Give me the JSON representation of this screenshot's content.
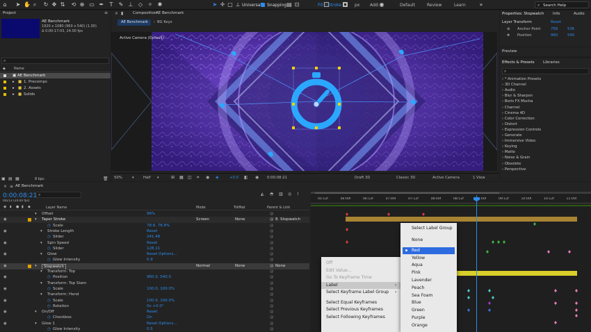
{
  "toolbar": {
    "universal_label": "Universal",
    "snapping_label": "Snapping",
    "fill_label": "Fill",
    "stroke_label": "Stroke",
    "px_label": "px",
    "add_label": "Add:",
    "workspaces": [
      "Default",
      "Review",
      "Learn"
    ],
    "search_placeholder": "Search Help"
  },
  "project": {
    "title": "Project",
    "comp_name": "AE Benchmark",
    "comp_info_1": "1920 x 1080 (960 x 540) (1.00)",
    "comp_info_2": "Δ 0:00:17:03, 24.00 fps",
    "search_placeholder": "",
    "column_name": "Name",
    "items": [
      {
        "name": "AE Benchmark",
        "color": "#d9d9d9",
        "selected": true
      },
      {
        "name": "1. Precomps",
        "color": "#e2c200",
        "selected": false
      },
      {
        "name": "2. Assets",
        "color": "#e2c200",
        "selected": false
      },
      {
        "name": "Solids",
        "color": "#e2c200",
        "selected": false
      }
    ],
    "bpc": "8 bpc"
  },
  "composition": {
    "panel_title": "Composition",
    "comp_name": "AE Benchmark",
    "tabs": [
      "AE Benchmark",
      "BG Keys"
    ],
    "camera_label": "Active Camera (Default)",
    "zoom": "50%",
    "resolution": "Half",
    "exposure": "+0.0",
    "timecode": "0:00:08:21",
    "renderer": "Draft 3D",
    "renderer_mode": "Classic 3D",
    "view": "Active Camera",
    "view_count": "1 View"
  },
  "properties": {
    "title": "Properties: Stopwatch",
    "tabs": [
      "Info",
      "Audio"
    ],
    "section": "Layer Transform",
    "reset": "Reset",
    "rows": [
      {
        "label": "Anchor Point",
        "v1": "758",
        "v2": "536"
      },
      {
        "label": "Position",
        "v1": "960",
        "v2": "540"
      }
    ],
    "preview_title": "Preview"
  },
  "effects": {
    "title": "Effects & Presets",
    "tab2": "Libraries",
    "categories": [
      "* Animation Presets",
      "3D Channel",
      "Audio",
      "Blur & Sharpen",
      "Boris FX Mocha",
      "Channel",
      "Cinema 4D",
      "Color Correction",
      "Distort",
      "Expression Controls",
      "Generate",
      "Immersive Video",
      "Keying",
      "Matte",
      "Noise & Grain",
      "Obsolete",
      "Perspective"
    ]
  },
  "timeline": {
    "tab": "AE Benchmark",
    "timecode": "0:00:08:21",
    "frames": "00213 (24.00 fps)",
    "column_headers": {
      "layer_name": "Layer Name",
      "mode": "Mode",
      "trkmat": "TrkMat",
      "parent": "Parent & Link"
    },
    "ruler": [
      "05:12f",
      "06:00f",
      "06:12f",
      "07:00f",
      "07:12f",
      "08:00f",
      "08:12f",
      "09:00f",
      "09:12f",
      "10:00f",
      "10:12f",
      "11:00f"
    ],
    "rows": [
      {
        "indent": 0,
        "name": "Offset",
        "value": "96%",
        "color": "",
        "mode": "",
        "trk": "",
        "parent": ""
      },
      {
        "indent": 0,
        "name": "Taper Stroke",
        "value": "",
        "color": "#e0a000",
        "mode": "Screen",
        "trk": "None",
        "parent": "8. Stopwatch"
      },
      {
        "indent": 2,
        "name": "Scale",
        "value": "78.8, 78.8%",
        "color": "",
        "mode": "",
        "trk": "",
        "parent": ""
      },
      {
        "indent": 1,
        "name": "Stroke Length",
        "value": "Reset",
        "color": "",
        "mode": "",
        "trk": "",
        "parent": ""
      },
      {
        "indent": 2,
        "name": "Slider",
        "value": "241.48",
        "color": "",
        "mode": "",
        "trk": "",
        "parent": ""
      },
      {
        "indent": 1,
        "name": "Spin Speed",
        "value": "Reset",
        "color": "",
        "mode": "",
        "trk": "",
        "parent": ""
      },
      {
        "indent": 2,
        "name": "Slider",
        "value": "128.11",
        "color": "",
        "mode": "",
        "trk": "",
        "parent": ""
      },
      {
        "indent": 1,
        "name": "Glow",
        "value": "Reset   Options...",
        "color": "",
        "mode": "",
        "trk": "",
        "parent": ""
      },
      {
        "indent": 2,
        "name": "Glow Intensity",
        "value": "0.9",
        "color": "",
        "mode": "",
        "trk": "",
        "parent": ""
      },
      {
        "indent": 0,
        "name": "Stopwatch",
        "value": "",
        "color": "#e0a000",
        "mode": "Normal",
        "trk": "None",
        "parent": "None"
      },
      {
        "indent": 1,
        "name": "Transform: Top",
        "value": "",
        "color": "",
        "mode": "",
        "trk": "",
        "parent": ""
      },
      {
        "indent": 2,
        "name": "Position",
        "value": "960.0, 540.0",
        "color": "",
        "mode": "",
        "trk": "",
        "parent": ""
      },
      {
        "indent": 1,
        "name": "Transform: Top Stem",
        "value": "",
        "color": "",
        "mode": "",
        "trk": "",
        "parent": ""
      },
      {
        "indent": 2,
        "name": "Scale",
        "value": "100.0, 100.0%",
        "color": "",
        "mode": "",
        "trk": "",
        "parent": ""
      },
      {
        "indent": 1,
        "name": "Transform: Hand",
        "value": "",
        "color": "",
        "mode": "",
        "trk": "",
        "parent": ""
      },
      {
        "indent": 2,
        "name": "Scale",
        "value": "100.0, 100.0%",
        "color": "",
        "mode": "",
        "trk": "",
        "parent": ""
      },
      {
        "indent": 2,
        "name": "Rotation",
        "value": "0x +0.0°",
        "color": "",
        "mode": "",
        "trk": "",
        "parent": ""
      },
      {
        "indent": 0,
        "name": "On/Off",
        "value": "Reset",
        "color": "",
        "mode": "",
        "trk": "",
        "parent": ""
      },
      {
        "indent": 2,
        "name": "Checkbox",
        "value": "On",
        "color": "",
        "mode": "",
        "trk": "",
        "parent": ""
      },
      {
        "indent": 0,
        "name": "Glow 1",
        "value": "Reset   Options...",
        "color": "",
        "mode": "",
        "trk": "",
        "parent": ""
      },
      {
        "indent": 2,
        "name": "Glow Intensity",
        "value": "0.5",
        "color": "",
        "mode": "",
        "trk": "",
        "parent": ""
      }
    ]
  },
  "context_menu": {
    "items": [
      {
        "label": "Off",
        "disabled": true,
        "submenu": false
      },
      {
        "label": "Edit Value...",
        "disabled": true,
        "submenu": false
      },
      {
        "label": "Go To Keyframe Time",
        "disabled": true,
        "submenu": false
      },
      {
        "label": "Label",
        "disabled": false,
        "submenu": true,
        "highlight": true
      },
      {
        "label": "Select Keyframe Label Group",
        "disabled": false,
        "submenu": true
      },
      {
        "label": "Select Equal Keyframes",
        "disabled": false,
        "submenu": false
      },
      {
        "label": "Select Previous Keyframes",
        "disabled": false,
        "submenu": false
      },
      {
        "label": "Select Following Keyframes",
        "disabled": false,
        "submenu": false
      }
    ]
  },
  "label_submenu": {
    "header": "Select Label Group",
    "items": [
      {
        "label": "None",
        "color": "",
        "selected": false
      },
      {
        "label": "Red",
        "color": "#d23c3c",
        "selected": true
      },
      {
        "label": "Yellow",
        "color": "#e2c200",
        "selected": false
      },
      {
        "label": "Aqua",
        "color": "#4cc9c9",
        "selected": false
      },
      {
        "label": "Pink",
        "color": "#e87ab8",
        "selected": false
      },
      {
        "label": "Lavender",
        "color": "#a8a0e0",
        "selected": false
      },
      {
        "label": "Peach",
        "color": "#e8b48c",
        "selected": false
      },
      {
        "label": "Sea Foam",
        "color": "#9ee0b8",
        "selected": false
      },
      {
        "label": "Blue",
        "color": "#3c6ee0",
        "selected": false
      },
      {
        "label": "Green",
        "color": "#3cb43c",
        "selected": false
      },
      {
        "label": "Purple",
        "color": "#9a3cc8",
        "selected": false
      },
      {
        "label": "Orange",
        "color": "#e07a28",
        "selected": false
      }
    ]
  },
  "colors": {
    "accent": "#2d8ceb",
    "bar_yellow": "#d9cf2a",
    "bar_orange": "#a88432",
    "highlight": "#2d6be0"
  }
}
